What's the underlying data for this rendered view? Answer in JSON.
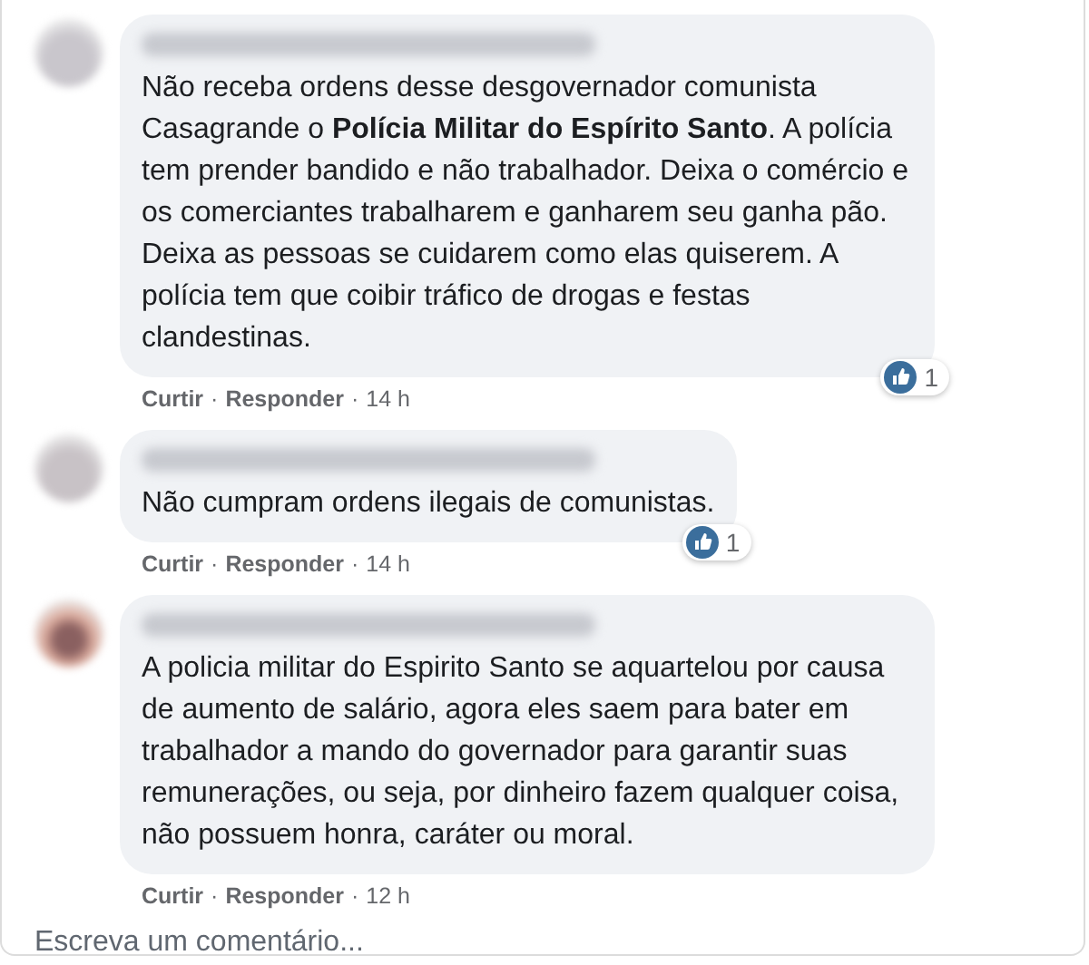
{
  "comments": [
    {
      "text": "Não receba ordens desse desgovernador comunista Casagrande o **Polícia Militar do Espírito Santo**. A polícia tem prender bandido e não trabalhador. Deixa o comércio e os comerciantes trabalharem e ganharem seu ganha pão. Deixa as pessoas se cuidarem como elas quiserem. A polícia tem que coibir tráfico de drogas e festas clandestinas.",
      "reaction_count": "1",
      "footer": [
        {
          "kind": "link",
          "text": "Curtir"
        },
        {
          "kind": "sep",
          "text": "·"
        },
        {
          "kind": "link",
          "text": "Responder"
        },
        {
          "kind": "sep",
          "text": "·"
        },
        {
          "kind": "time",
          "text": "14 h"
        }
      ]
    },
    {
      "text": "Não cumpram ordens ilegais de comunistas.",
      "reaction_count": "1",
      "footer": [
        {
          "kind": "link",
          "text": "Curtir"
        },
        {
          "kind": "sep",
          "text": "·"
        },
        {
          "kind": "link",
          "text": "Responder"
        },
        {
          "kind": "sep",
          "text": "·"
        },
        {
          "kind": "time",
          "text": "14 h"
        }
      ]
    },
    {
      "text": "A policia militar do Espirito Santo se aquartelou por causa de aumento de salário, agora eles saem para bater em trabalhador a mando do governador para garantir suas remunerações, ou seja, por dinheiro fazem qualquer coisa, não possuem honra, caráter ou moral.",
      "footer": [
        {
          "kind": "link",
          "text": "Curtir"
        },
        {
          "kind": "sep",
          "text": "·"
        },
        {
          "kind": "link",
          "text": "Responder"
        },
        {
          "kind": "sep",
          "text": "·"
        },
        {
          "kind": "time",
          "text": "12 h"
        }
      ]
    }
  ],
  "comment_box": {
    "placeholder": "Escreva um comentário..."
  }
}
